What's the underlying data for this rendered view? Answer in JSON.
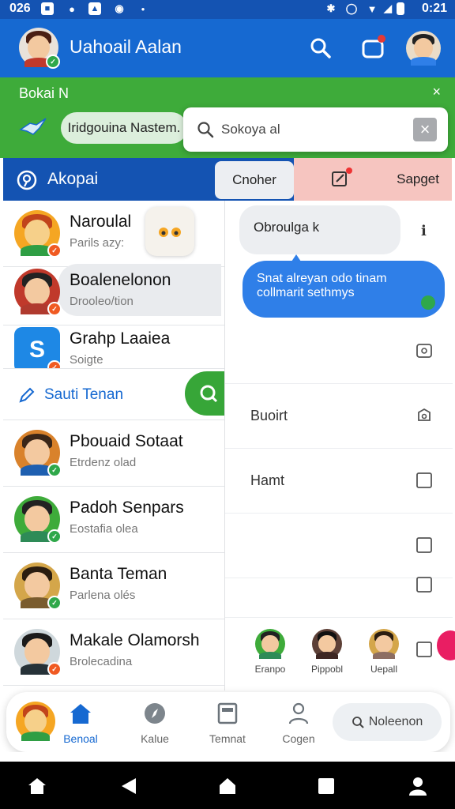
{
  "status_bar": {
    "time_left": "026",
    "time_right": "0:21"
  },
  "app_bar": {
    "title": "Uahoail Aalan",
    "icons": [
      "search-icon",
      "chat-icon",
      "profile-avatar"
    ]
  },
  "banner": {
    "label": "Bokai Ν",
    "chip": "Iridgouina Nastem.",
    "close": "×"
  },
  "search": {
    "value": "Sokoya al",
    "clear": "×"
  },
  "section": {
    "title": "Akopai"
  },
  "tabs": {
    "active": "Cnoher",
    "save": "Sapget"
  },
  "chats": [
    {
      "name": "Naroulal",
      "sub": "Parils azy:",
      "badge": "orange"
    },
    {
      "name": "Boalenelonon",
      "sub": "Drooleo/tion",
      "badge": "orange"
    },
    {
      "name": "Grahp Laaiea",
      "sub": "Soigte",
      "badge": "orange"
    }
  ],
  "search_row": {
    "label": "Sauti Tenan"
  },
  "chats2": [
    {
      "name": "Pbouaid Sotaat",
      "sub": "Etrdenz olad",
      "badge": "green"
    },
    {
      "name": "Padoh Senpars",
      "sub": "Eostafia olea",
      "badge": "green"
    },
    {
      "name": "Banta Teman",
      "sub": "Parlena olés",
      "badge": "green"
    },
    {
      "name": "Makale Olamorsh",
      "sub": "Brolecadina",
      "badge": "orange"
    }
  ],
  "right_panel": {
    "bubble_grey": "Obroulga k",
    "bubble_blue": "Snat alreyan odo tinam collmarit sethmys",
    "options": [
      "",
      "Buoirt",
      "Hamt",
      "",
      ""
    ],
    "contacts": [
      "Eranpo",
      "Pippobl",
      "Uepall"
    ]
  },
  "bottom_nav": {
    "items": [
      "Benoal",
      "Kalue",
      "Temnat",
      "Cogen"
    ],
    "search": "Noleenon"
  }
}
